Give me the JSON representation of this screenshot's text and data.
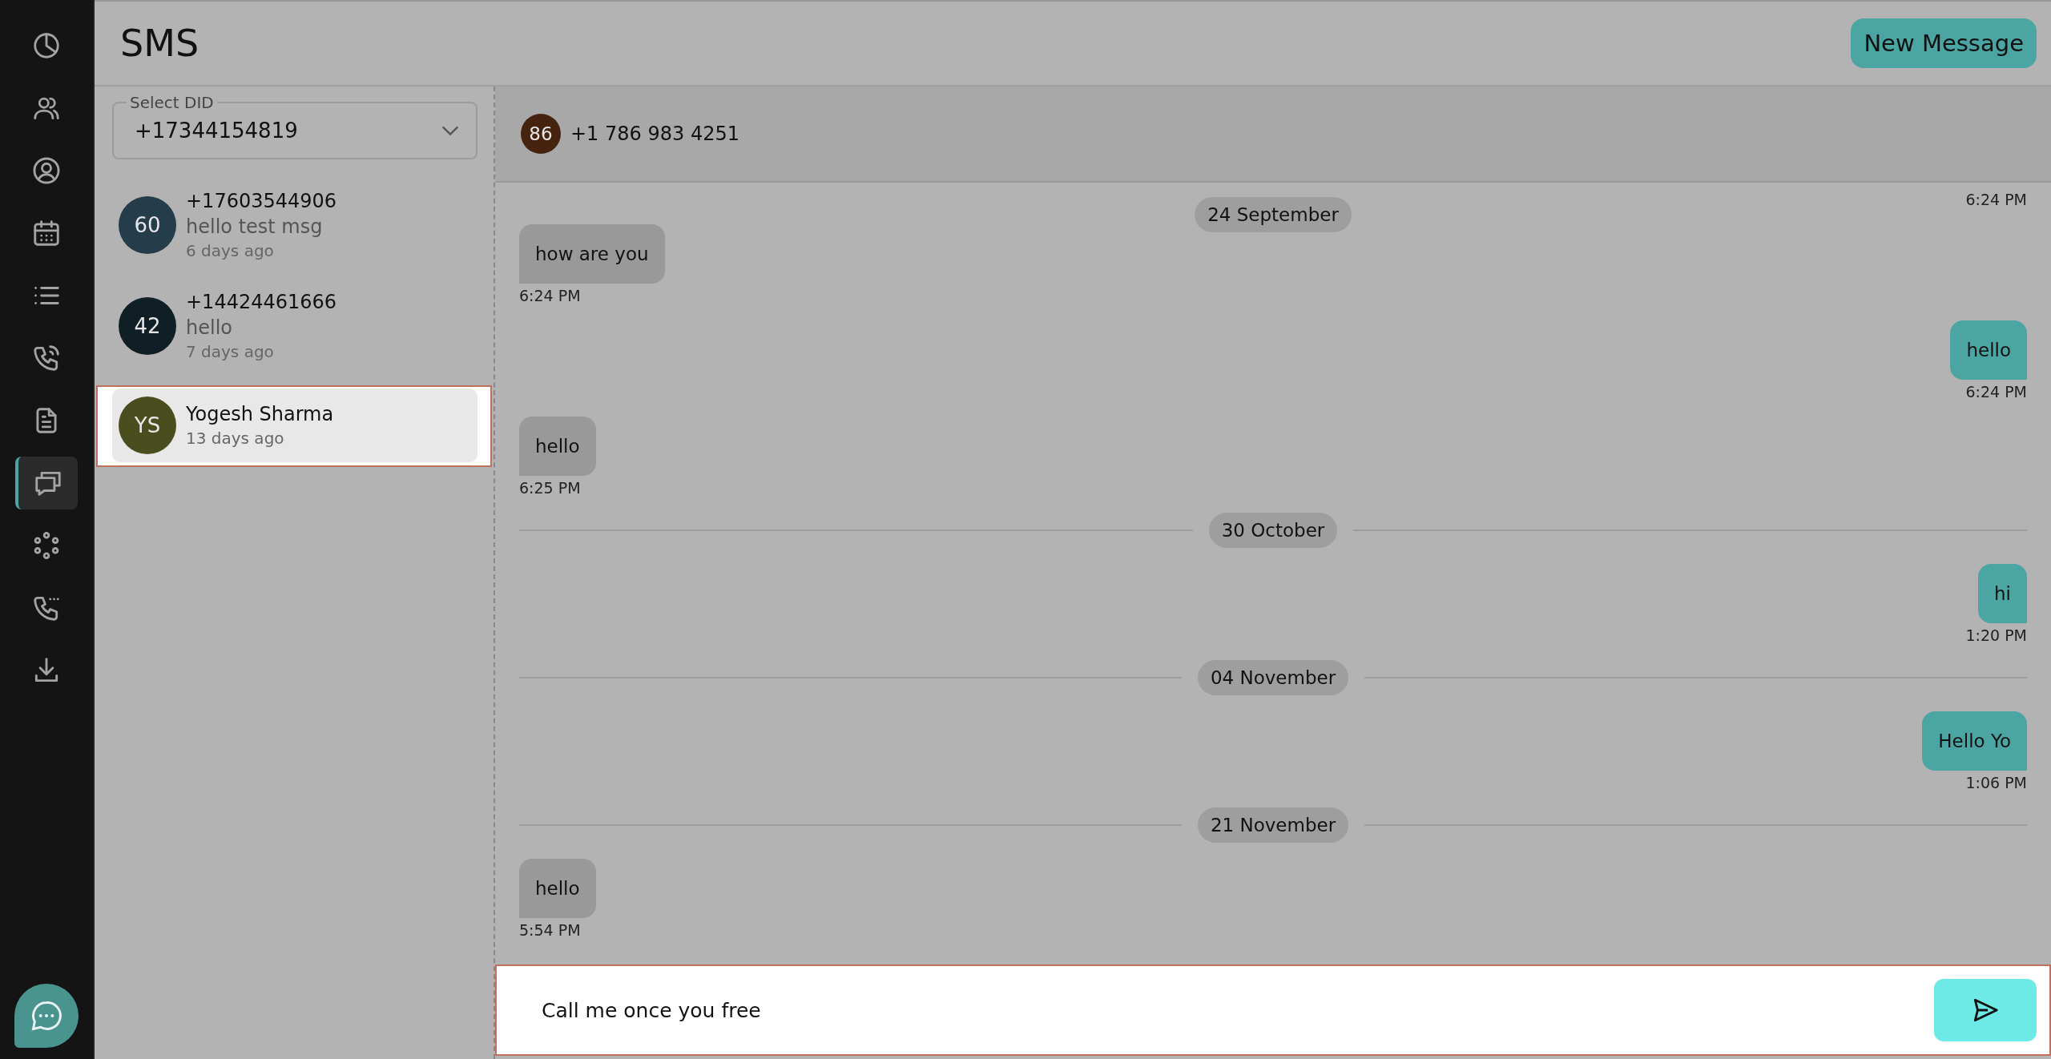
{
  "app": {
    "title": "SMS",
    "new_message_button": "New Message"
  },
  "nav": [
    {
      "kind": "pie",
      "selected": false
    },
    {
      "kind": "users",
      "selected": false
    },
    {
      "kind": "user",
      "selected": false
    },
    {
      "kind": "calendar",
      "selected": false
    },
    {
      "kind": "list",
      "selected": false
    },
    {
      "kind": "phone-call",
      "selected": false
    },
    {
      "kind": "document",
      "selected": false
    },
    {
      "kind": "chat",
      "selected": true
    },
    {
      "kind": "dots",
      "selected": false
    },
    {
      "kind": "phone-dots",
      "selected": false
    },
    {
      "kind": "download",
      "selected": false
    }
  ],
  "did_select": {
    "label": "Select DID",
    "value": "+17344154819"
  },
  "conversations": [
    {
      "avatar": "60",
      "color": "#253c4b",
      "name": "+17603544906",
      "preview": "hello test msg",
      "time": "6 days ago",
      "selected": false
    },
    {
      "avatar": "42",
      "color": "#0f1f25",
      "name": "+14424461666",
      "preview": "hello",
      "time": "7 days ago",
      "selected": false
    },
    {
      "avatar": "YS",
      "color": "#4a4d1e",
      "name": "Yogesh Sharma",
      "time": "13 days ago",
      "selected": true
    }
  ],
  "chat": {
    "avatar": "86",
    "color": "#45230f",
    "contact": "+1 786 983 4251",
    "sticky_date": "24 September",
    "items": [
      {
        "kind": "time",
        "outgoing": true,
        "text": "6:24 PM"
      },
      {
        "kind": "message",
        "outgoing": false,
        "text": "how are you",
        "time": "6:24 PM"
      },
      {
        "kind": "message",
        "outgoing": true,
        "text": "hello",
        "time": "6:24 PM"
      },
      {
        "kind": "message",
        "outgoing": false,
        "text": "hello",
        "time": "6:25 PM"
      },
      {
        "kind": "date",
        "text": "30 October"
      },
      {
        "kind": "message",
        "outgoing": true,
        "text": "hi",
        "time": "1:20 PM"
      },
      {
        "kind": "date",
        "text": "04 November"
      },
      {
        "kind": "message",
        "outgoing": true,
        "text": "Hello Yo",
        "time": "1:06 PM"
      },
      {
        "kind": "date",
        "text": "21 November"
      },
      {
        "kind": "message",
        "outgoing": false,
        "text": "hello",
        "time": "5:54 PM"
      }
    ]
  },
  "composer": {
    "value": "Call me once you free"
  }
}
